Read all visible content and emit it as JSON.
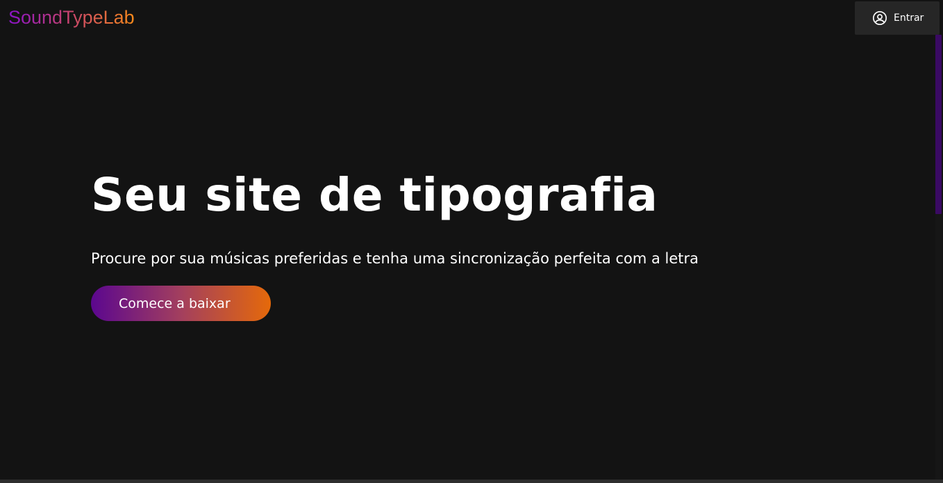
{
  "header": {
    "logo_text": "SoundTypeLab",
    "login": {
      "icon": "user-circle-icon",
      "label": "Entrar"
    }
  },
  "hero": {
    "title": "Seu site de tipografia",
    "subtitle": "Procure por sua músicas preferidas e tenha uma sincronização perfeita com a letra",
    "cta_label": "Comece a baixar"
  },
  "colors": {
    "background": "#131313",
    "logo_gradient": [
      "#8a12c9",
      "#c8456a",
      "#f98a1a"
    ],
    "cta_gradient": [
      "#5b078f",
      "#a33f5e",
      "#e5690a"
    ],
    "scrollbar_thumb": "#3a0a63",
    "login_button_bg": "#262626"
  }
}
